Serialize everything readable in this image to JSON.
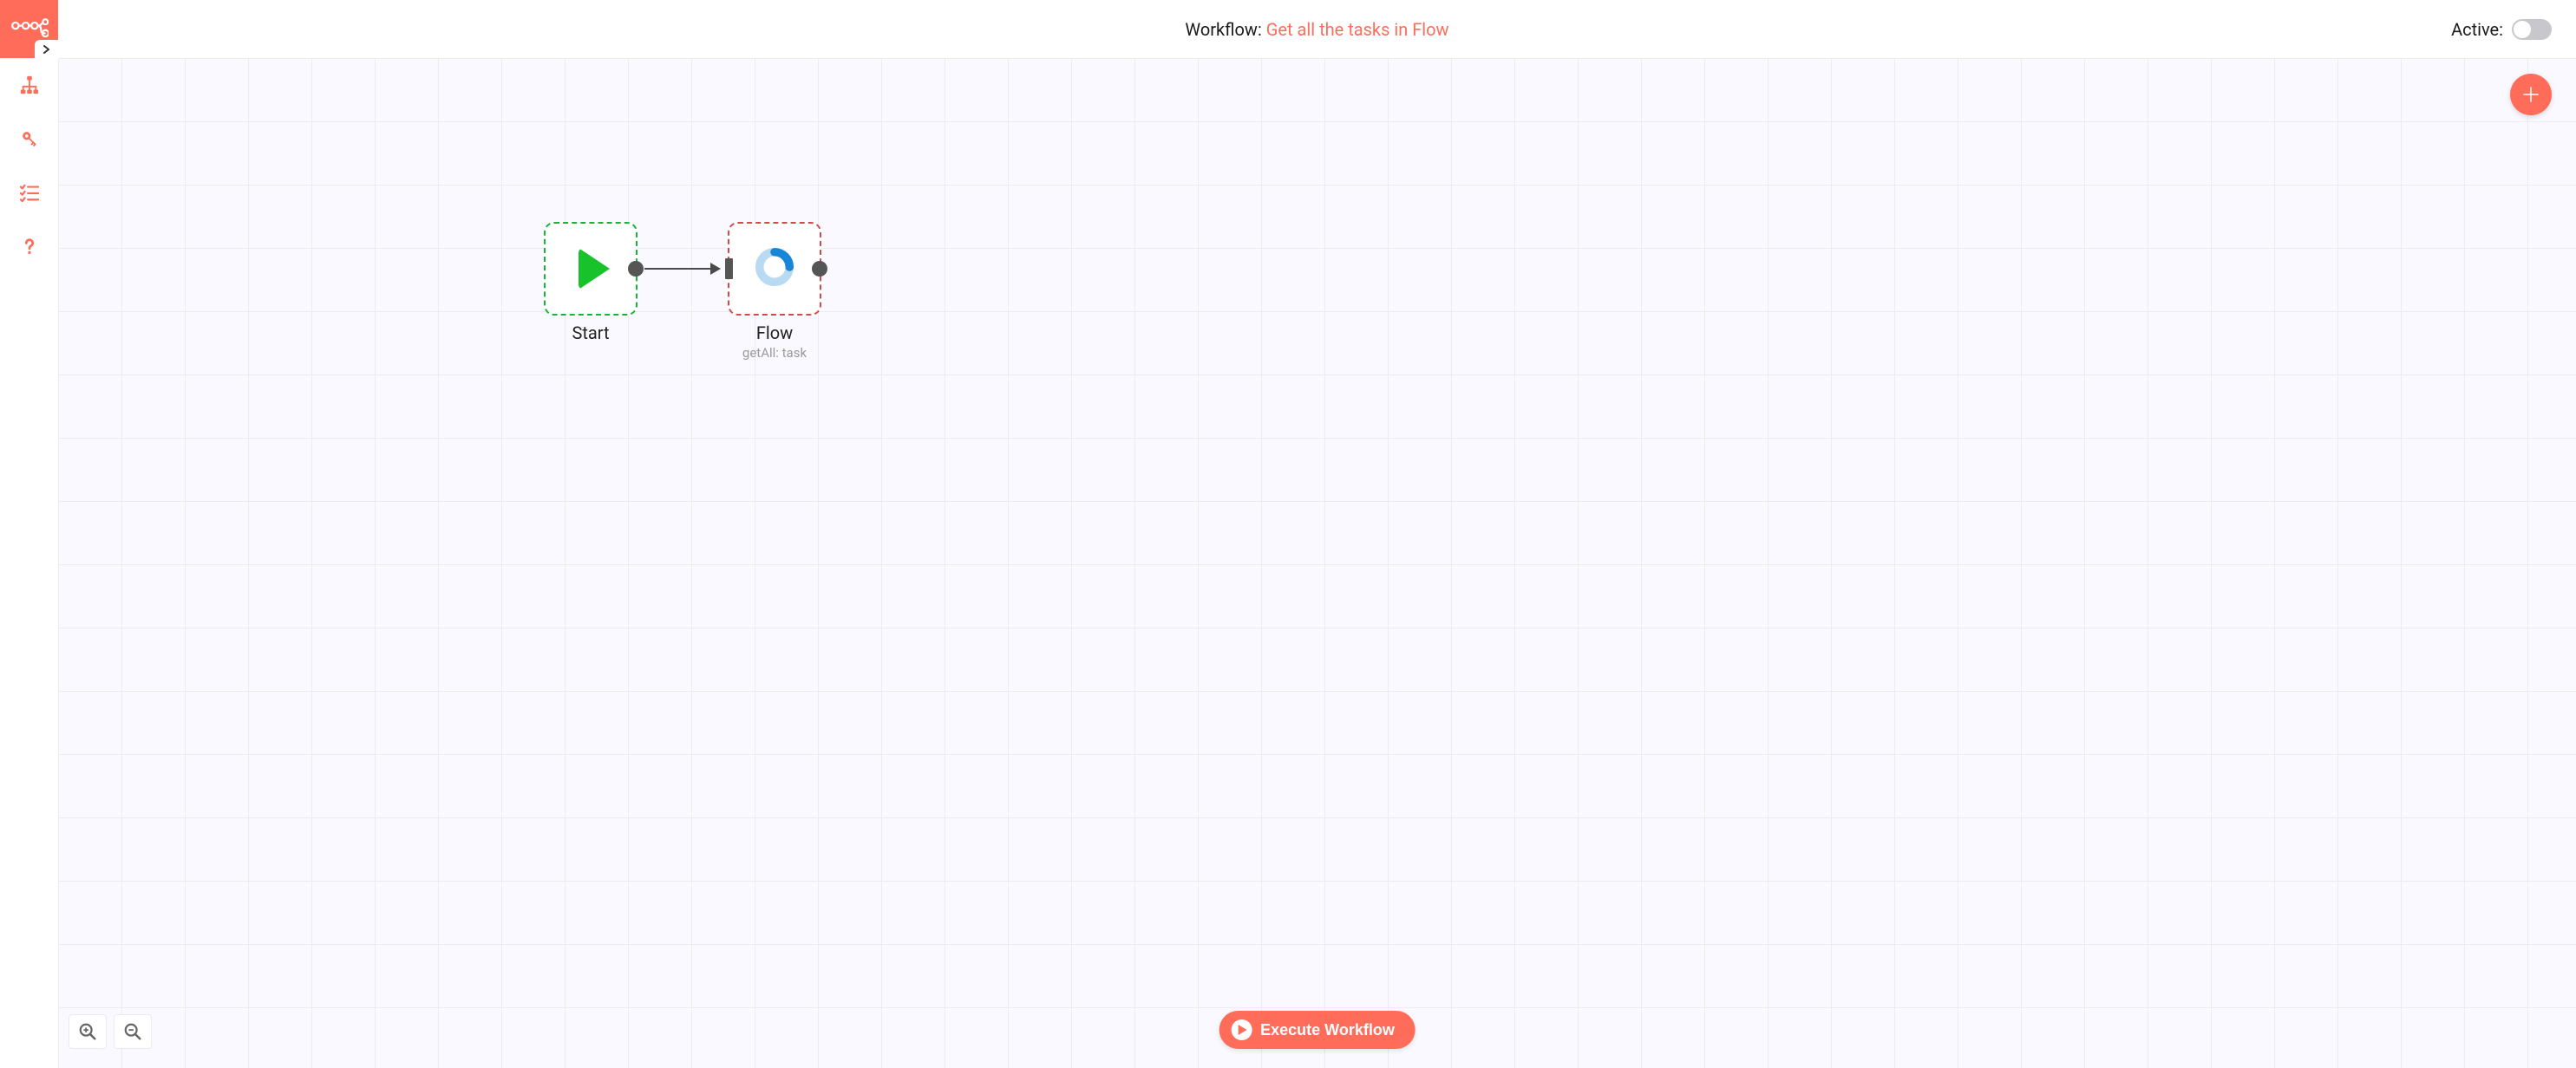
{
  "header": {
    "prefix": "Workflow: ",
    "name": "Get all the tasks in Flow",
    "active_label": "Active:"
  },
  "toggle": {
    "on": false
  },
  "sidebar": {
    "items": [
      {
        "id": "workflows",
        "icon": "sitemap-icon"
      },
      {
        "id": "credentials",
        "icon": "key-icon"
      },
      {
        "id": "executions",
        "icon": "checklist-icon"
      },
      {
        "id": "help",
        "icon": "question-icon"
      }
    ]
  },
  "buttons": {
    "execute": "Execute Workflow"
  },
  "nodes": {
    "start": {
      "label": "Start"
    },
    "flow": {
      "label": "Flow",
      "subtitle": "getAll: task"
    }
  },
  "colors": {
    "accent": "#ff6d5a",
    "start_border": "#17b43a",
    "flow_border": "#d24a4a"
  }
}
